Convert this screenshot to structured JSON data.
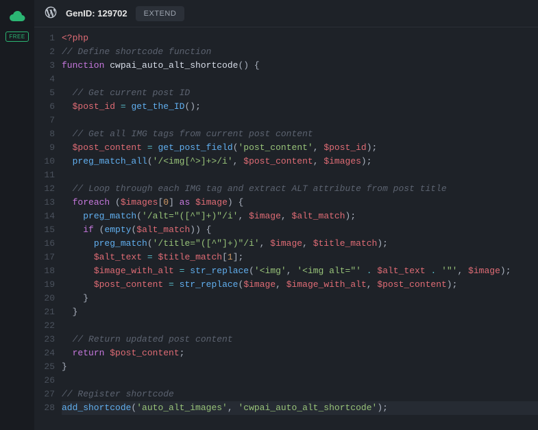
{
  "sidebar": {
    "badge": "FREE"
  },
  "header": {
    "title_prefix": "GenID:",
    "gen_id": "129702",
    "extend_label": "EXTEND"
  },
  "editor": {
    "language": "php",
    "current_line": 28,
    "lines": [
      [
        [
          "php-open",
          "<?php"
        ]
      ],
      [
        [
          "comment",
          "// Define shortcode function"
        ]
      ],
      [
        [
          "keyword",
          "function"
        ],
        [
          "punct",
          " "
        ],
        [
          "funcname",
          "cwpai_auto_alt_shortcode"
        ],
        [
          "punct",
          "() {"
        ]
      ],
      [],
      [
        [
          "punct",
          "  "
        ],
        [
          "comment",
          "// Get current post ID"
        ]
      ],
      [
        [
          "punct",
          "  "
        ],
        [
          "var",
          "$post_id"
        ],
        [
          "punct",
          " "
        ],
        [
          "op",
          "="
        ],
        [
          "punct",
          " "
        ],
        [
          "func",
          "get_the_ID"
        ],
        [
          "punct",
          "();"
        ]
      ],
      [],
      [
        [
          "punct",
          "  "
        ],
        [
          "comment",
          "// Get all IMG tags from current post content"
        ]
      ],
      [
        [
          "punct",
          "  "
        ],
        [
          "var",
          "$post_content"
        ],
        [
          "punct",
          " "
        ],
        [
          "op",
          "="
        ],
        [
          "punct",
          " "
        ],
        [
          "func",
          "get_post_field"
        ],
        [
          "punct",
          "("
        ],
        [
          "string",
          "'post_content'"
        ],
        [
          "punct",
          ", "
        ],
        [
          "var",
          "$post_id"
        ],
        [
          "punct",
          ");"
        ]
      ],
      [
        [
          "punct",
          "  "
        ],
        [
          "func",
          "preg_match_all"
        ],
        [
          "punct",
          "("
        ],
        [
          "string",
          "'/<img[^>]+>/i'"
        ],
        [
          "punct",
          ", "
        ],
        [
          "var",
          "$post_content"
        ],
        [
          "punct",
          ", "
        ],
        [
          "var",
          "$images"
        ],
        [
          "punct",
          ");"
        ]
      ],
      [],
      [
        [
          "punct",
          "  "
        ],
        [
          "comment",
          "// Loop through each IMG tag and extract ALT attribute from post title"
        ]
      ],
      [
        [
          "punct",
          "  "
        ],
        [
          "keyword",
          "foreach"
        ],
        [
          "punct",
          " ("
        ],
        [
          "var",
          "$images"
        ],
        [
          "punct",
          "["
        ],
        [
          "number",
          "0"
        ],
        [
          "punct",
          "] "
        ],
        [
          "keyword",
          "as"
        ],
        [
          "punct",
          " "
        ],
        [
          "var",
          "$image"
        ],
        [
          "punct",
          ") {"
        ]
      ],
      [
        [
          "punct",
          "    "
        ],
        [
          "func",
          "preg_match"
        ],
        [
          "punct",
          "("
        ],
        [
          "string",
          "'/alt=\"([^\"]+)\"/i'"
        ],
        [
          "punct",
          ", "
        ],
        [
          "var",
          "$image"
        ],
        [
          "punct",
          ", "
        ],
        [
          "var",
          "$alt_match"
        ],
        [
          "punct",
          ");"
        ]
      ],
      [
        [
          "punct",
          "    "
        ],
        [
          "keyword",
          "if"
        ],
        [
          "punct",
          " ("
        ],
        [
          "func",
          "empty"
        ],
        [
          "punct",
          "("
        ],
        [
          "var",
          "$alt_match"
        ],
        [
          "punct",
          ")) {"
        ]
      ],
      [
        [
          "punct",
          "      "
        ],
        [
          "func",
          "preg_match"
        ],
        [
          "punct",
          "("
        ],
        [
          "string",
          "'/title=\"([^\"]+)\"/i'"
        ],
        [
          "punct",
          ", "
        ],
        [
          "var",
          "$image"
        ],
        [
          "punct",
          ", "
        ],
        [
          "var",
          "$title_match"
        ],
        [
          "punct",
          ");"
        ]
      ],
      [
        [
          "punct",
          "      "
        ],
        [
          "var",
          "$alt_text"
        ],
        [
          "punct",
          " "
        ],
        [
          "op",
          "="
        ],
        [
          "punct",
          " "
        ],
        [
          "var",
          "$title_match"
        ],
        [
          "punct",
          "["
        ],
        [
          "number",
          "1"
        ],
        [
          "punct",
          "];"
        ]
      ],
      [
        [
          "punct",
          "      "
        ],
        [
          "var",
          "$image_with_alt"
        ],
        [
          "punct",
          " "
        ],
        [
          "op",
          "="
        ],
        [
          "punct",
          " "
        ],
        [
          "func",
          "str_replace"
        ],
        [
          "punct",
          "("
        ],
        [
          "string",
          "'<img'"
        ],
        [
          "punct",
          ", "
        ],
        [
          "string",
          "'<img alt=\"'"
        ],
        [
          "punct",
          " "
        ],
        [
          "op",
          "."
        ],
        [
          "punct",
          " "
        ],
        [
          "var",
          "$alt_text"
        ],
        [
          "punct",
          " "
        ],
        [
          "op",
          "."
        ],
        [
          "punct",
          " "
        ],
        [
          "string",
          "'\"'"
        ],
        [
          "punct",
          ", "
        ],
        [
          "var",
          "$image"
        ],
        [
          "punct",
          ");"
        ]
      ],
      [
        [
          "punct",
          "      "
        ],
        [
          "var",
          "$post_content"
        ],
        [
          "punct",
          " "
        ],
        [
          "op",
          "="
        ],
        [
          "punct",
          " "
        ],
        [
          "func",
          "str_replace"
        ],
        [
          "punct",
          "("
        ],
        [
          "var",
          "$image"
        ],
        [
          "punct",
          ", "
        ],
        [
          "var",
          "$image_with_alt"
        ],
        [
          "punct",
          ", "
        ],
        [
          "var",
          "$post_content"
        ],
        [
          "punct",
          ");"
        ]
      ],
      [
        [
          "punct",
          "    }"
        ]
      ],
      [
        [
          "punct",
          "  }"
        ]
      ],
      [],
      [
        [
          "punct",
          "  "
        ],
        [
          "comment",
          "// Return updated post content"
        ]
      ],
      [
        [
          "punct",
          "  "
        ],
        [
          "keyword",
          "return"
        ],
        [
          "punct",
          " "
        ],
        [
          "var",
          "$post_content"
        ],
        [
          "punct",
          ";"
        ]
      ],
      [
        [
          "punct",
          "}"
        ]
      ],
      [],
      [
        [
          "comment",
          "// Register shortcode"
        ]
      ],
      [
        [
          "func",
          "add_shortcode"
        ],
        [
          "punct",
          "("
        ],
        [
          "string",
          "'auto_alt_images'"
        ],
        [
          "punct",
          ", "
        ],
        [
          "string",
          "'cwpai_auto_alt_shortcode'"
        ],
        [
          "punct",
          ");"
        ]
      ]
    ]
  }
}
